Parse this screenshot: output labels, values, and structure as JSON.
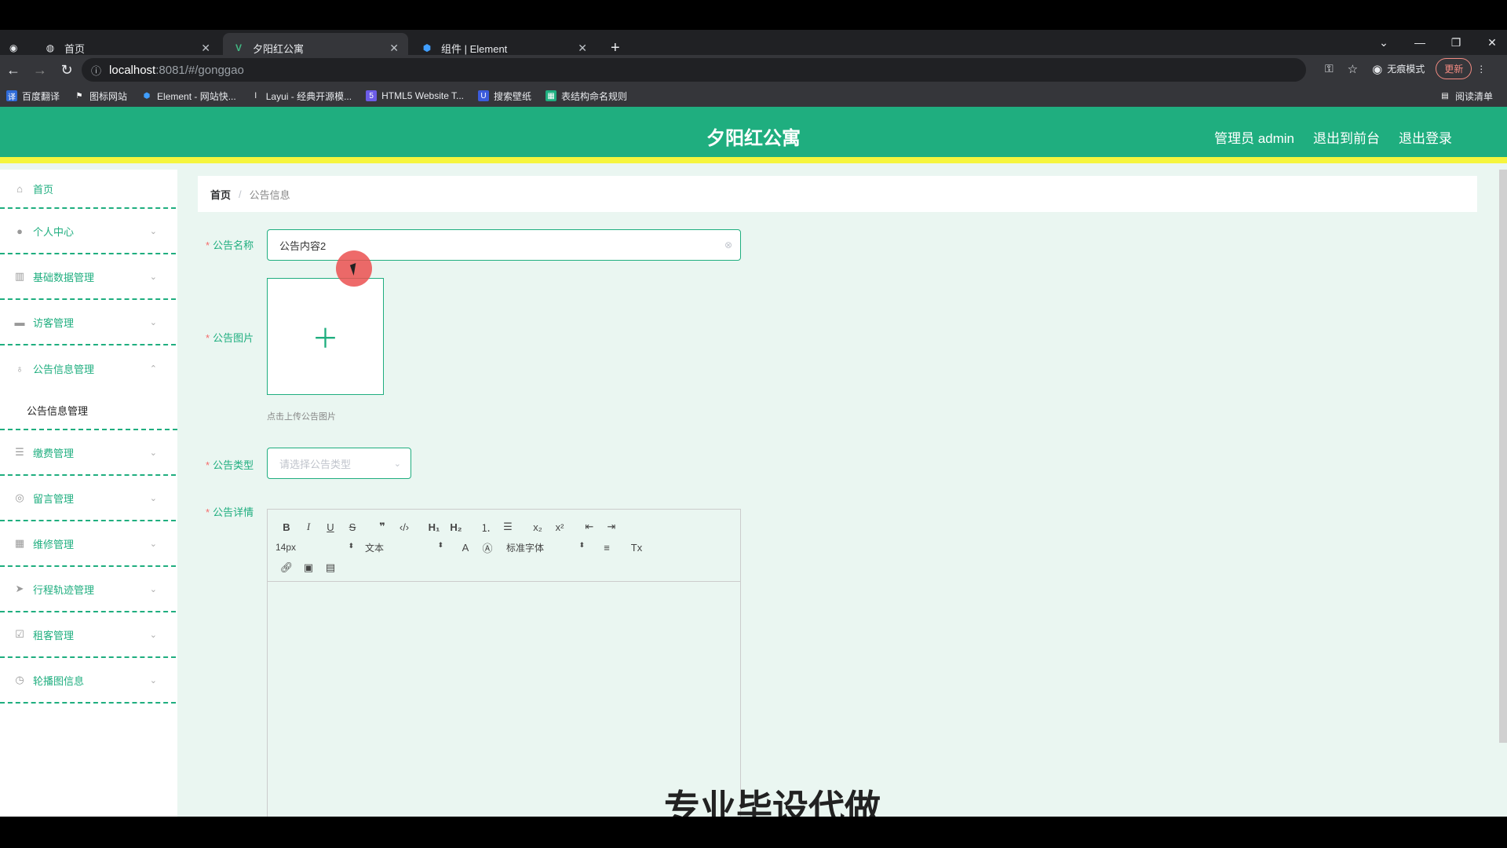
{
  "browser": {
    "tabs": [
      {
        "title": "首页",
        "active": false
      },
      {
        "title": "夕阳红公寓",
        "active": true
      },
      {
        "title": "组件 | Element",
        "active": false
      }
    ],
    "new_tab": "+",
    "url_host": "localhost",
    "url_path": ":8081/#/gonggao",
    "incognito_label": "无痕模式",
    "update_label": "更新",
    "reading_list": "阅读清单",
    "bookmarks": [
      {
        "label": "百度翻译",
        "color": "#2f6bd8"
      },
      {
        "label": "图标网站",
        "color": "#35363a"
      },
      {
        "label": "Element - 网站快...",
        "color": "#409eff"
      },
      {
        "label": "Layui - 经典开源模...",
        "color": "#35363a"
      },
      {
        "label": "HTML5 Website T...",
        "color": "#6c5ce7"
      },
      {
        "label": "搜索壁纸",
        "color": "#3b5bdb"
      },
      {
        "label": "表结构命名规则",
        "color": "#1fae7f"
      }
    ]
  },
  "header": {
    "title": "夕阳红公寓",
    "admin": "管理员 admin",
    "to_front": "退出到前台",
    "logout": "退出登录"
  },
  "sidebar": {
    "items": [
      {
        "label": "首页",
        "icon": "home-icon"
      },
      {
        "label": "个人中心",
        "icon": "user-icon"
      },
      {
        "label": "基础数据管理",
        "icon": "chart-icon"
      },
      {
        "label": "访客管理",
        "icon": "monitor-icon"
      },
      {
        "label": "公告信息管理",
        "icon": "microphone-icon"
      },
      {
        "label": "缴费管理",
        "icon": "sliders-icon"
      },
      {
        "label": "留言管理",
        "icon": "globe-icon"
      },
      {
        "label": "维修管理",
        "icon": "grid-icon"
      },
      {
        "label": "行程轨迹管理",
        "icon": "navigation-icon"
      },
      {
        "label": "租客管理",
        "icon": "checklist-icon"
      },
      {
        "label": "轮播图信息",
        "icon": "clock-icon"
      }
    ],
    "submenu_active": "公告信息管理"
  },
  "breadcrumb": {
    "home": "首页",
    "separator": "/",
    "current": "公告信息"
  },
  "form": {
    "name_label": "公告名称",
    "name_value": "公告内容2",
    "image_label": "公告图片",
    "upload_tip": "点击上传公告图片",
    "type_label": "公告类型",
    "type_placeholder": "请选择公告类型",
    "detail_label": "公告详情"
  },
  "editor": {
    "font_size": "14px",
    "header_picker": "文本",
    "font_family": "标准字体"
  },
  "overlay_caption": "专业毕设代做",
  "colors": {
    "primary": "#1fae7f",
    "accent_bar": "#f5f53d",
    "required": "#f56c6c"
  }
}
